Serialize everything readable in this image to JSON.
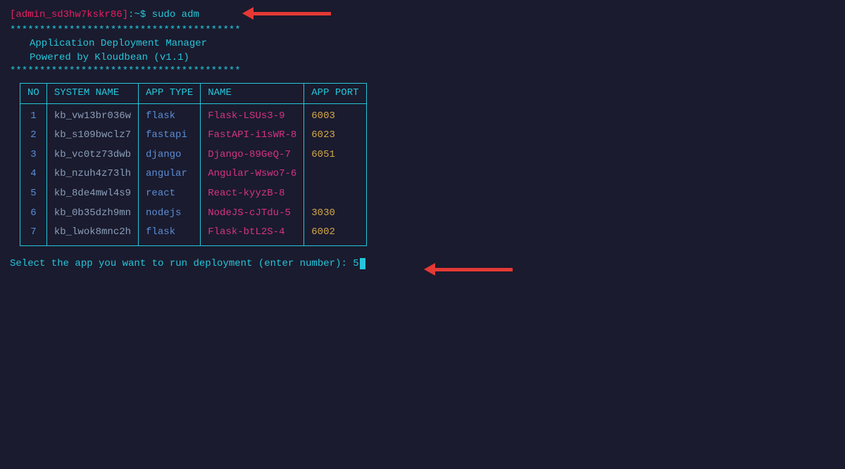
{
  "prompt": {
    "open_bracket": "[",
    "user": "admin_sd3hw7kskr86",
    "close_bracket": "]",
    "host_sep": ":",
    "path": "~",
    "dollar": "$",
    "command": "sudo adm"
  },
  "banner": {
    "stars": "***************************************",
    "line1": "Application Deployment Manager",
    "line2": "Powered by Kloudbean (v1.1)"
  },
  "table": {
    "headers": {
      "no": "NO",
      "system": "SYSTEM NAME",
      "type": "APP TYPE",
      "name": "NAME",
      "port": "APP PORT"
    },
    "rows": [
      {
        "no": "1",
        "system": "kb_vw13br036w",
        "type": "flask",
        "name": "Flask-LSUs3-9",
        "port": "6003"
      },
      {
        "no": "2",
        "system": "kb_s109bwclz7",
        "type": "fastapi",
        "name": "FastAPI-i1sWR-8",
        "port": "6023"
      },
      {
        "no": "3",
        "system": "kb_vc0tz73dwb",
        "type": "django",
        "name": "Django-89GeQ-7",
        "port": "6051"
      },
      {
        "no": "4",
        "system": "kb_nzuh4z73lh",
        "type": "angular",
        "name": "Angular-Wswo7-6",
        "port": ""
      },
      {
        "no": "5",
        "system": "kb_8de4mwl4s9",
        "type": "react",
        "name": "React-kyyzB-8",
        "port": ""
      },
      {
        "no": "6",
        "system": "kb_0b35dzh9mn",
        "type": "nodejs",
        "name": "NodeJS-cJTdu-5",
        "port": "3030"
      },
      {
        "no": "7",
        "system": "kb_lwok8mnc2h",
        "type": "flask",
        "name": "Flask-btL2S-4",
        "port": "6002"
      }
    ]
  },
  "select": {
    "prompt": "Select the app you want to run deployment (enter number): ",
    "value": "5"
  }
}
